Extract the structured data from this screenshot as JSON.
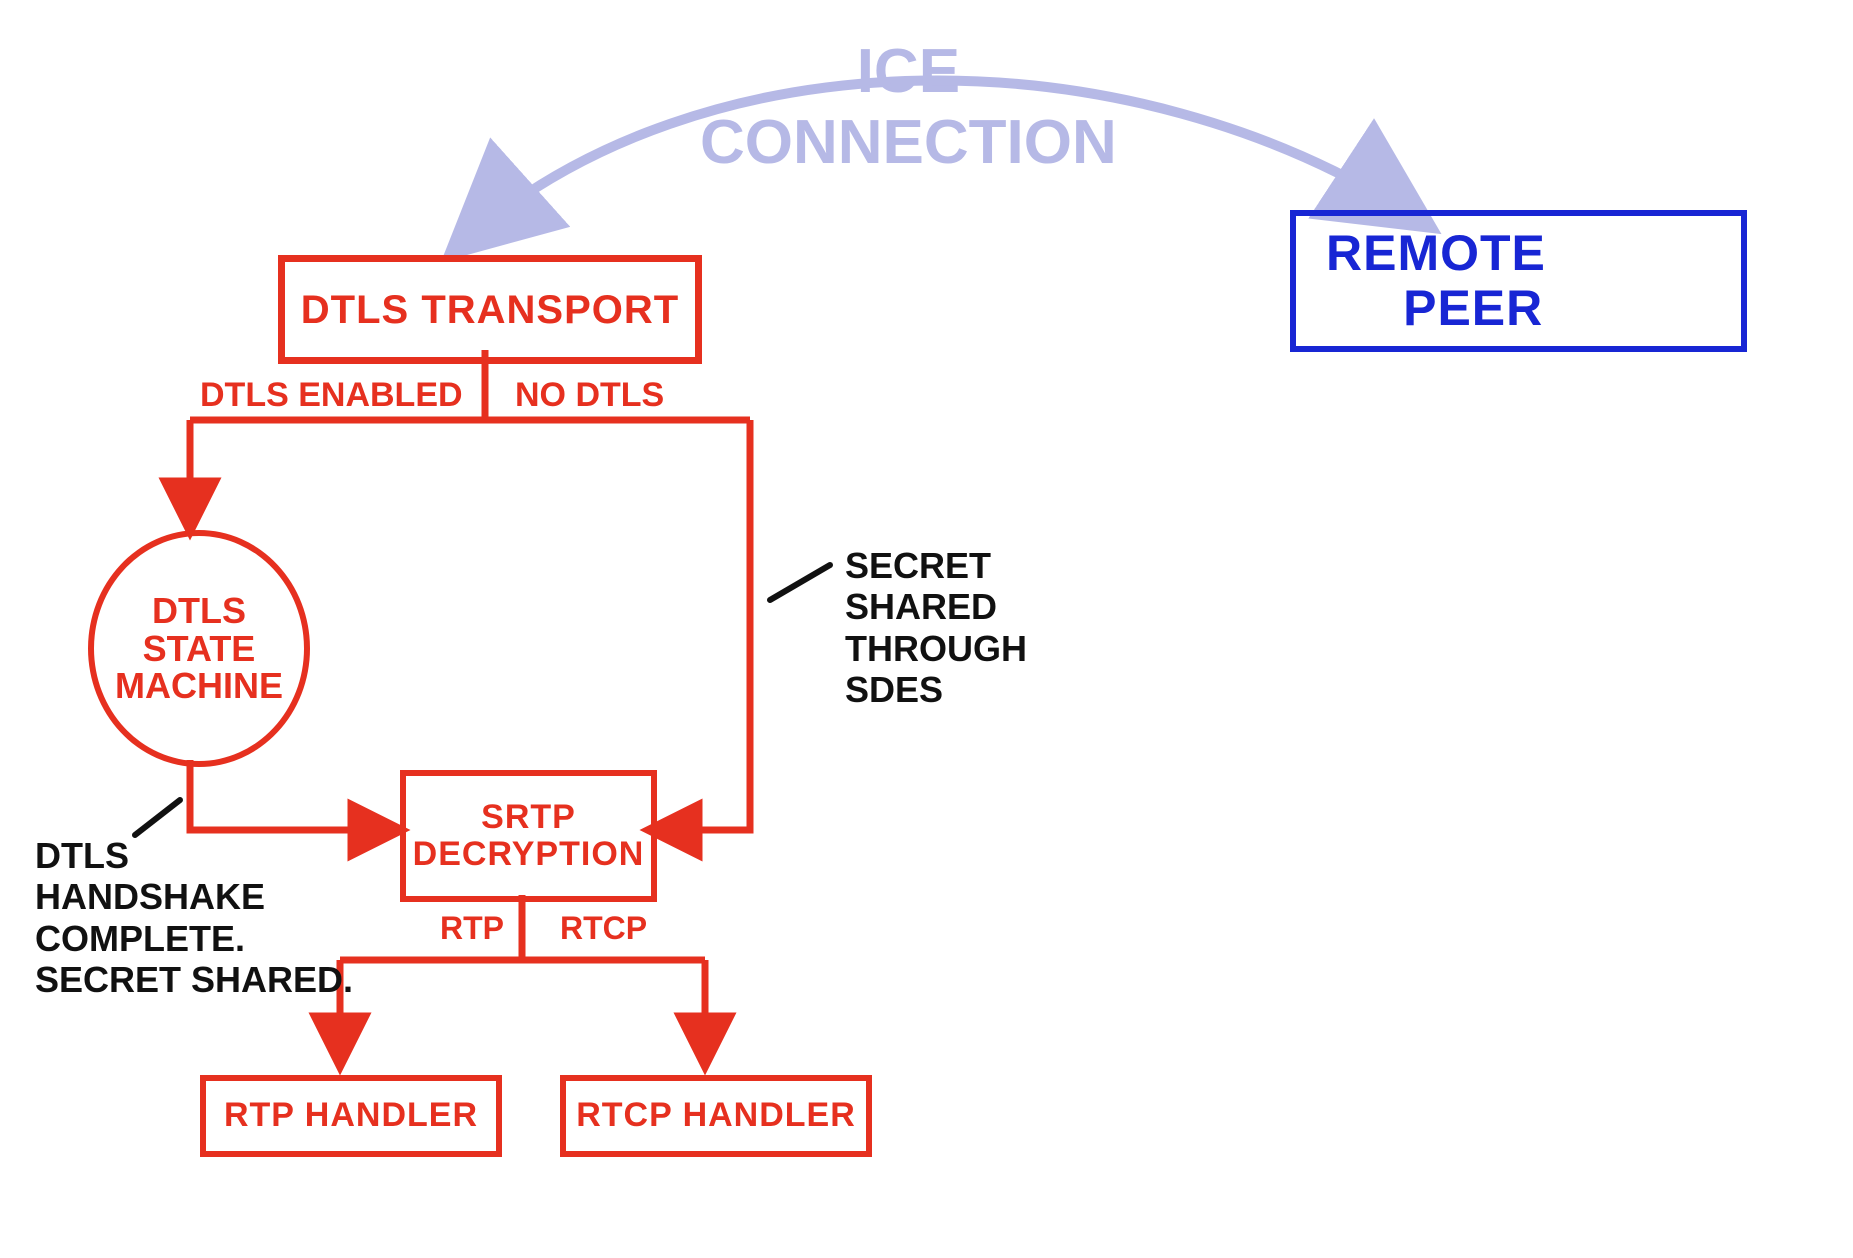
{
  "colors": {
    "red": "#e6301f",
    "blue": "#1826d4",
    "black": "#111111",
    "lavender": "#b6b9e6"
  },
  "nodes": {
    "dtls_transport": "DTLS TRANSPORT",
    "remote_peer": "REMOTE\n     PEER",
    "dtls_state_machine": "DTLS\nSTATE\nMACHINE",
    "srtp_decryption": "SRTP\nDECRYPTION",
    "rtp_handler": "RTP HANDLER",
    "rtcp_handler": "RTCP HANDLER"
  },
  "edges": {
    "ice_connection": "ICE\nCONNECTION",
    "dtls_enabled": "DTLS ENABLED",
    "no_dtls": "NO DTLS",
    "rtp": "RTP",
    "rtcp": "RTCP"
  },
  "annotations": {
    "secret_sdes": "SECRET\nSHARED\nTHROUGH\nSDES",
    "dtls_complete": "DTLS\nHANDSHAKE\nCOMPLETE.\nSECRET SHARED."
  },
  "chart_data": {
    "type": "diagram",
    "title": "DTLS Transport / SRTP flow",
    "nodes": [
      {
        "id": "dtls_transport",
        "label": "DTLS TRANSPORT",
        "shape": "rect",
        "color": "red"
      },
      {
        "id": "remote_peer",
        "label": "REMOTE PEER",
        "shape": "rect",
        "color": "blue"
      },
      {
        "id": "dtls_state_machine",
        "label": "DTLS STATE MACHINE",
        "shape": "ellipse",
        "color": "red"
      },
      {
        "id": "srtp_decryption",
        "label": "SRTP DECRYPTION",
        "shape": "rect",
        "color": "red"
      },
      {
        "id": "rtp_handler",
        "label": "RTP HANDLER",
        "shape": "rect",
        "color": "red"
      },
      {
        "id": "rtcp_handler",
        "label": "RTCP HANDLER",
        "shape": "rect",
        "color": "red"
      }
    ],
    "edges": [
      {
        "from": "dtls_transport",
        "to": "remote_peer",
        "label": "ICE CONNECTION",
        "bidirectional": true,
        "color": "lavender"
      },
      {
        "from": "dtls_transport",
        "to": "dtls_state_machine",
        "label": "DTLS ENABLED",
        "color": "red"
      },
      {
        "from": "dtls_transport",
        "to": "srtp_decryption",
        "label": "NO DTLS",
        "annotation": "SECRET SHARED THROUGH SDES",
        "color": "red"
      },
      {
        "from": "dtls_state_machine",
        "to": "srtp_decryption",
        "annotation": "DTLS HANDSHAKE COMPLETE. SECRET SHARED.",
        "color": "red"
      },
      {
        "from": "srtp_decryption",
        "to": "rtp_handler",
        "label": "RTP",
        "color": "red"
      },
      {
        "from": "srtp_decryption",
        "to": "rtcp_handler",
        "label": "RTCP",
        "color": "red"
      }
    ]
  }
}
